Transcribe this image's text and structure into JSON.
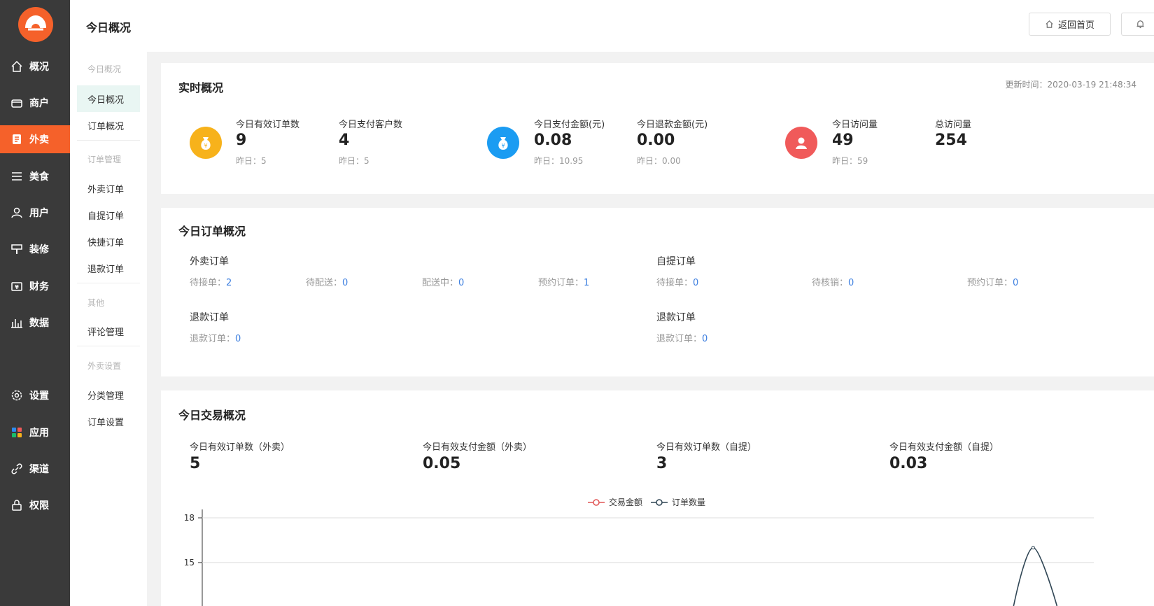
{
  "nav": {
    "items": [
      {
        "label": "概况",
        "icon": "home-icon"
      },
      {
        "label": "商户",
        "icon": "store-icon"
      },
      {
        "label": "外卖",
        "icon": "takeout-icon",
        "active": true
      },
      {
        "label": "美食",
        "icon": "menu-lines-icon"
      },
      {
        "label": "用户",
        "icon": "user-icon"
      },
      {
        "label": "装修",
        "icon": "decorate-icon"
      },
      {
        "label": "财务",
        "icon": "wallet-icon"
      },
      {
        "label": "数据",
        "icon": "bar-chart-icon"
      },
      {
        "label": "设置",
        "icon": "gear-icon"
      },
      {
        "label": "应用",
        "icon": "apps-icon"
      },
      {
        "label": "渠道",
        "icon": "link-icon"
      },
      {
        "label": "权限",
        "icon": "lock-icon"
      }
    ]
  },
  "subnav": {
    "groups": [
      {
        "title": "今日概况",
        "items": [
          "今日概况",
          "订单概况"
        ]
      },
      {
        "title": "订单管理",
        "items": [
          "外卖订单",
          "自提订单",
          "快捷订单",
          "退款订单"
        ]
      },
      {
        "title": "其他",
        "items": [
          "评论管理"
        ]
      },
      {
        "title": "外卖设置",
        "items": [
          "分类管理",
          "订单设置"
        ]
      }
    ]
  },
  "header": {
    "title": "今日概况",
    "home_button": "返回首页"
  },
  "realtime": {
    "title": "实时概况",
    "updated": "更新时间：2020-03-19 21:48:34",
    "stats": [
      {
        "label": "今日有效订单数",
        "value": "9",
        "sub": "昨日：5"
      },
      {
        "label": "今日支付客户数",
        "value": "4",
        "sub": "昨日：5"
      },
      {
        "label": "今日支付金额(元)",
        "value": "0.08",
        "sub": "昨日：10.95"
      },
      {
        "label": "今日退款金额(元)",
        "value": "0.00",
        "sub": "昨日：0.00"
      },
      {
        "label": "今日访问量",
        "value": "49",
        "sub": "昨日：59"
      },
      {
        "label": "总访问量",
        "value": "254",
        "sub": ""
      }
    ],
    "icon_colors": [
      "#f7b21b",
      "#1b9cf2",
      "#f05a5a"
    ]
  },
  "orders": {
    "title": "今日订单概况",
    "takeout": {
      "title": "外卖订单",
      "items": [
        {
          "label": "待接单：",
          "value": "2"
        },
        {
          "label": "待配送：",
          "value": "0"
        },
        {
          "label": "配送中：",
          "value": "0"
        },
        {
          "label": "预约订单：",
          "value": "1"
        }
      ]
    },
    "pickup": {
      "title": "自提订单",
      "items": [
        {
          "label": "待接单：",
          "value": "0"
        },
        {
          "label": "待核销：",
          "value": "0"
        },
        {
          "label": "预约订单：",
          "value": "0"
        }
      ]
    },
    "refund_left": {
      "title": "退款订单",
      "label": "退款订单：",
      "value": "0"
    },
    "refund_right": {
      "title": "退款订单",
      "label": "退款订单：",
      "value": "0"
    }
  },
  "transactions": {
    "title": "今日交易概况",
    "stats": [
      {
        "label": "今日有效订单数（外卖）",
        "value": "5"
      },
      {
        "label": "今日有效支付金额（外卖）",
        "value": "0.05"
      },
      {
        "label": "今日有效订单数（自提）",
        "value": "3"
      },
      {
        "label": "今日有效支付金额（自提）",
        "value": "0.03"
      }
    ]
  },
  "chart_data": {
    "type": "line",
    "series": [
      {
        "name": "交易金额",
        "color": "#e05555",
        "values": []
      },
      {
        "name": "订单数量",
        "color": "#2f4554",
        "peak_x": 0.932,
        "peak_y": 16
      }
    ],
    "y_ticks": [
      "18",
      "15"
    ],
    "ylim": [
      0,
      18
    ],
    "grid": true,
    "legend": "top-center"
  }
}
